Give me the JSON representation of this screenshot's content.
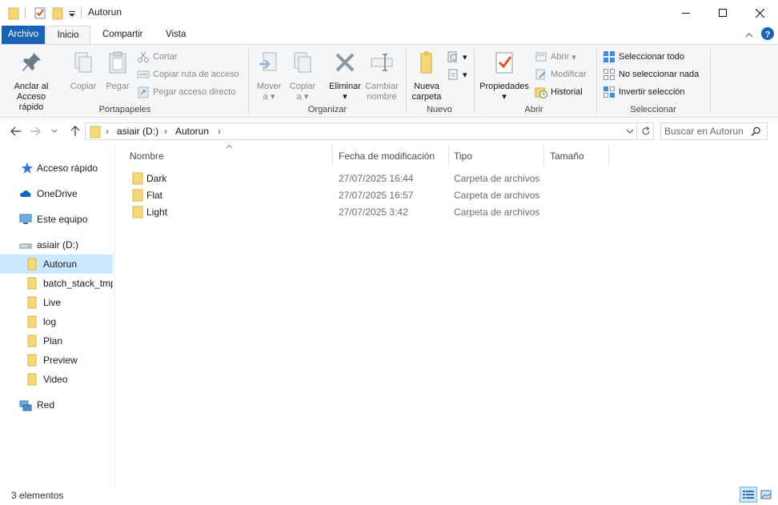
{
  "window": {
    "title": "Autorun",
    "minimize_icon": "minimize-icon",
    "maximize_icon": "maximize-icon",
    "close_icon": "close-icon"
  },
  "ribbon_tabs": {
    "file": "Archivo",
    "home": "Inicio",
    "share": "Compartir",
    "view": "Vista"
  },
  "ribbon": {
    "clipboard": {
      "label": "Portapapeles",
      "pin": [
        "Anclar al",
        "Acceso rápido"
      ],
      "copy": "Copiar",
      "paste": "Pegar",
      "cut": "Cortar",
      "copy_path": "Copiar ruta de acceso",
      "paste_shortcut": "Pegar acceso directo"
    },
    "organize": {
      "label": "Organizar",
      "move": [
        "Mover",
        "a"
      ],
      "copy_to": [
        "Copiar",
        "a"
      ],
      "delete": "Eliminar",
      "rename": [
        "Cambiar",
        "nombre"
      ]
    },
    "new": {
      "label": "Nuevo",
      "new_folder": [
        "Nueva",
        "carpeta"
      ]
    },
    "open": {
      "label": "Abrir",
      "properties": "Propiedades",
      "open": "Abrir",
      "edit": "Modificar",
      "history": "Historial"
    },
    "select": {
      "label": "Seleccionar",
      "select_all": "Seleccionar todo",
      "select_none": "No seleccionar nada",
      "invert": "Invertir selección"
    }
  },
  "address": {
    "crumbs": [
      "asiair (D:)",
      "Autorun"
    ],
    "search_placeholder": "Buscar en Autorun"
  },
  "nav": {
    "quick_access": "Acceso rápido",
    "onedrive": "OneDrive",
    "this_pc": "Este equipo",
    "drive": "asiair (D:)",
    "folders": [
      "Autorun",
      "batch_stack_tmp",
      "Live",
      "log",
      "Plan",
      "Preview",
      "Video"
    ],
    "network": "Red"
  },
  "columns": {
    "name": "Nombre",
    "date": "Fecha de modificación",
    "type": "Tipo",
    "size": "Tamaño"
  },
  "files": [
    {
      "name": "Dark",
      "date": "27/07/2025 16:44",
      "type": "Carpeta de archivos"
    },
    {
      "name": "Flat",
      "date": "27/07/2025 16:57",
      "type": "Carpeta de archivos"
    },
    {
      "name": "Light",
      "date": "27/07/2025 3:42",
      "type": "Carpeta de archivos"
    }
  ],
  "status": {
    "count": "3 elementos"
  },
  "colors": {
    "accent": "#1a62b8",
    "selection": "#cce8ff",
    "folder": "#f8d775"
  }
}
